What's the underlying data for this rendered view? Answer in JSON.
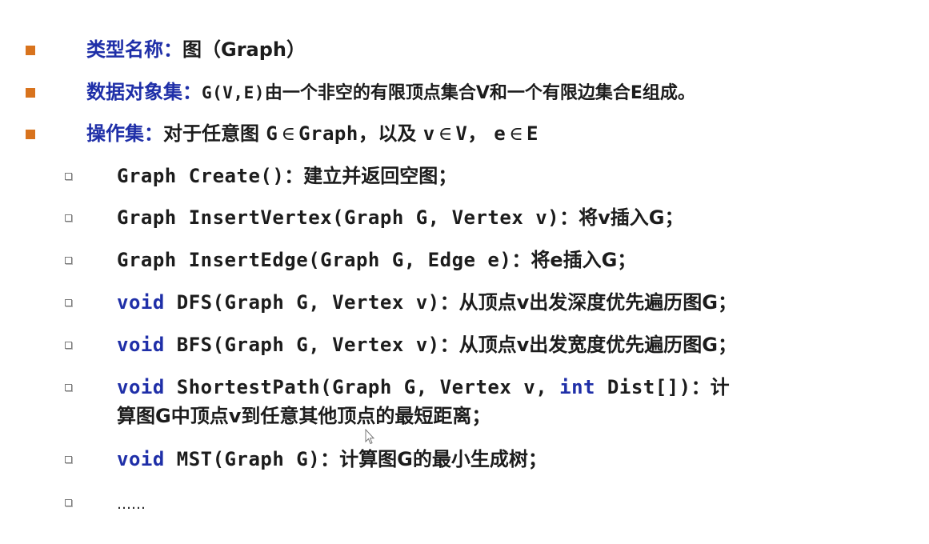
{
  "colors": {
    "main_bullet": "#d8731d",
    "label_blue": "#1f2fa8",
    "text": "#1c1c1c",
    "background": "#ffffff"
  },
  "items": {
    "type_name": {
      "label": "类型名称：",
      "value": "图（Graph）"
    },
    "data_object_set": {
      "label": "数据对象集：",
      "code": "G(V,E)",
      "text": "由一个非空的有限顶点集合V和一个有限边集合E组成。"
    },
    "operation_set": {
      "label": "操作集：",
      "intro": "对于任意图",
      "g": "G",
      "in1": "∈",
      "graph": "Graph，",
      "also": "以及",
      "v": "v",
      "in2": "∈",
      "V": "V，",
      "e": "e",
      "in3": "∈",
      "E": "E"
    }
  },
  "operations": {
    "create": {
      "code": "Graph Create()",
      "desc": "：建立并返回空图；"
    },
    "insert_vertex": {
      "code": "Graph InsertVertex(Graph G, Vertex v)",
      "desc": "：将v插入G；"
    },
    "insert_edge": {
      "code": "Graph InsertEdge(Graph G, Edge e)",
      "desc": "：将e插入G；"
    },
    "dfs": {
      "kw": "void",
      "code": " DFS(Graph G, Vertex v)",
      "desc": "：从顶点v出发深度优先遍历图G；"
    },
    "bfs": {
      "kw": "void",
      "code": " BFS(Graph G, Vertex v)",
      "desc": "：从顶点v出发宽度优先遍历图G；"
    },
    "shortest_path": {
      "kw": "void",
      "code1": " ShortestPath(Graph G, Vertex v, ",
      "kw2": "int",
      "code2": " Dist[])",
      "desc1": "：计",
      "desc2": "算图G中顶点v到任意其他顶点的最短距离；"
    },
    "mst": {
      "kw": "void",
      "code": " MST(Graph G)",
      "desc": "：计算图G的最小生成树；"
    },
    "more": {
      "text": "……"
    }
  }
}
